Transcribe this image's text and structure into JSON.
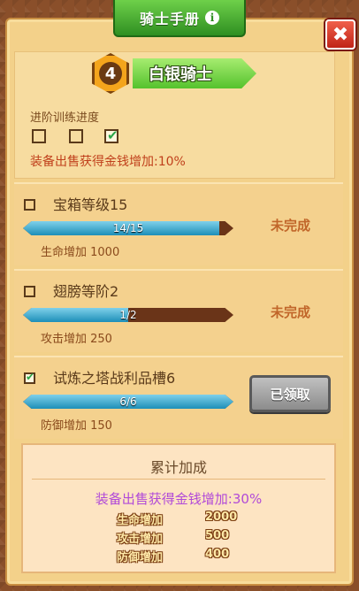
{
  "window": {
    "title": "骑士手册",
    "info_icon": "info-icon",
    "close_icon": "close-icon",
    "close_glyph": "✖"
  },
  "rank": {
    "level": "4",
    "name": "白银骑士"
  },
  "advancement": {
    "label": "进阶训练进度",
    "checkboxes": [
      false,
      false,
      true
    ],
    "reward": "装备出售获得金钱增加:10%"
  },
  "quests": [
    {
      "name": "宝箱等级15",
      "checked": false,
      "progress_text": "14/15",
      "progress": 0.933,
      "bonus": "生命增加 1000",
      "status": "未完成"
    },
    {
      "name": "翅膀等阶2",
      "checked": false,
      "progress_text": "1/2",
      "progress": 0.5,
      "bonus": "攻击增加 250",
      "status": "未完成"
    },
    {
      "name": "试炼之塔战利品槽6",
      "checked": true,
      "progress_text": "6/6",
      "progress": 1.0,
      "bonus": "防御增加 150",
      "button": "已领取"
    }
  ],
  "summary": {
    "title": "累计加成",
    "total": "装备出售获得金钱增加:30%",
    "stats": [
      {
        "label": "生命增加",
        "value": "2000"
      },
      {
        "label": "攻击增加",
        "value": "500"
      },
      {
        "label": "防御增加",
        "value": "400"
      }
    ]
  },
  "colors": {
    "accent_green": "#55c22d",
    "bar_blue": "#1d8fb8",
    "status_orange": "#c1662a",
    "total_purple": "#b14ad8"
  }
}
